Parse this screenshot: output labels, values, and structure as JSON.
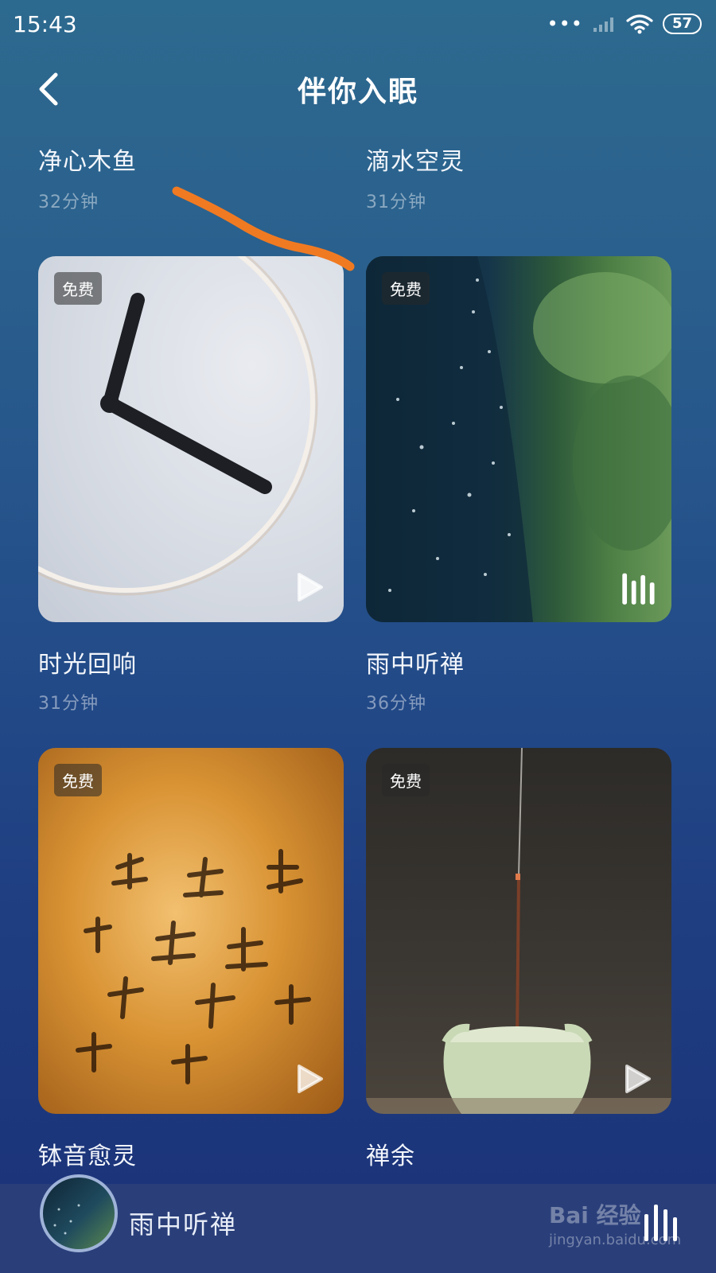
{
  "status_bar": {
    "time": "15:43",
    "battery": "57",
    "icons": [
      "more-dots-icon",
      "signal-icon",
      "wifi-icon",
      "battery-icon"
    ]
  },
  "header": {
    "title": "伴你入眠",
    "back_icon": "chevron-left-icon"
  },
  "top_items": [
    {
      "title": "净心木鱼",
      "duration": "32分钟"
    },
    {
      "title": "滴水空灵",
      "duration": "31分钟"
    }
  ],
  "cards": [
    {
      "title": "时光回响",
      "duration": "31分钟",
      "badge": "免费",
      "state": "play",
      "image": "clock-image"
    },
    {
      "title": "雨中听禅",
      "duration": "36分钟",
      "badge": "免费",
      "state": "playing",
      "image": "rain-image"
    },
    {
      "title": "钵音愈灵",
      "badge": "免费",
      "state": "play",
      "image": "calligraphy-image"
    },
    {
      "title": "禅余",
      "badge": "免费",
      "state": "play",
      "image": "incense-image"
    }
  ],
  "player": {
    "title": "雨中听禅",
    "icon": "equalizer-icon"
  },
  "watermark": {
    "brand": "Bai 经验",
    "url": "jingyan.baidu.com"
  },
  "colors": {
    "background_top": "#2d6a8f",
    "background_bottom": "#1b3178",
    "player_bar": "#2a3f7a",
    "annotation": "#f07a22"
  }
}
